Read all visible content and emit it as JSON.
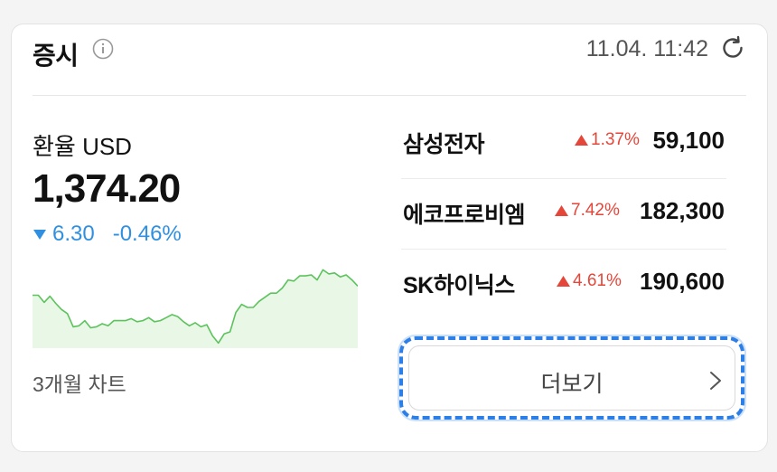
{
  "header": {
    "title": "증시",
    "timestamp": "11.04. 11:42"
  },
  "exchange": {
    "label": "환율 USD",
    "value": "1,374.20",
    "change": "6.30",
    "change_pct": "-0.46%",
    "direction": "down",
    "chart_label": "3개월 차트",
    "colors": {
      "line": "#5cc35c",
      "fill": "#e8f7e6",
      "down": "#2f8fe0"
    }
  },
  "stocks": [
    {
      "name": "삼성전자",
      "change_pct": "1.37%",
      "price": "59,100",
      "direction": "up"
    },
    {
      "name": "에코프로비엠",
      "change_pct": "7.42%",
      "price": "182,300",
      "direction": "up"
    },
    {
      "name": "SK하이닉스",
      "change_pct": "4.61%",
      "price": "190,600",
      "direction": "up"
    }
  ],
  "more_button": {
    "label": "더보기"
  },
  "icons": [
    "info-icon",
    "refresh-icon",
    "down-triangle-icon",
    "up-triangle-icon",
    "chevron-right-icon"
  ],
  "accent_colors": {
    "up": "#e5463a",
    "down": "#2f8fe0",
    "focus_ring": "#2d7fe8"
  },
  "chart_data": {
    "type": "area",
    "values": [
      52,
      52,
      45,
      51,
      44,
      38,
      34,
      21,
      22,
      27,
      20,
      21,
      24,
      22,
      27,
      27,
      27,
      29,
      26,
      27,
      30,
      26,
      27,
      30,
      33,
      31,
      26,
      22,
      25,
      21,
      23,
      12,
      5,
      14,
      16,
      35,
      43,
      40,
      40,
      46,
      50,
      54,
      54,
      59,
      67,
      66,
      71,
      71,
      72,
      67,
      77,
      73,
      74,
      70,
      72,
      67,
      61
    ],
    "ylim": [
      0,
      80
    ],
    "grid": false
  }
}
